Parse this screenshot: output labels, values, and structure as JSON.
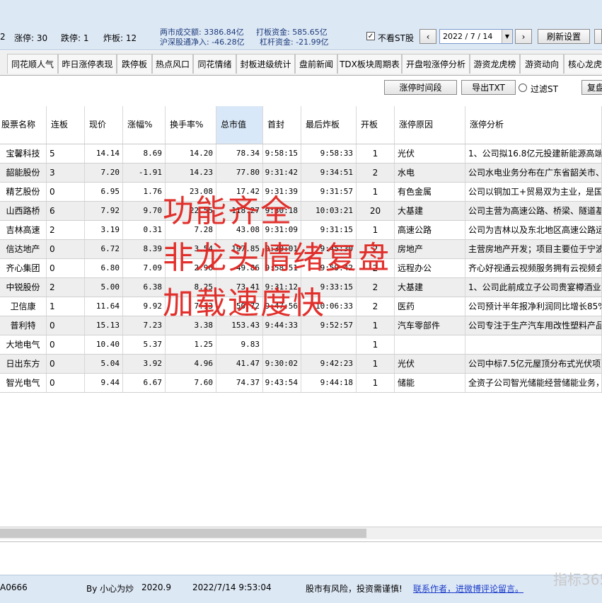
{
  "stats": {
    "limit_up_partial": "2",
    "limit_up": "涨停: 30",
    "limit_down": "跌停: 1",
    "broken": "炸板: 12"
  },
  "market": {
    "turnover": "两市成交额: 3386.84亿",
    "hit_funds": "打板资金: 585.65亿",
    "north_flow": "沪深股通净入: -46.28亿",
    "leverage_funds": "杠杆资金: -21.99亿"
  },
  "controls": {
    "hide_st_checked": true,
    "hide_st_label": "不看ST股",
    "prev_arrow": "‹",
    "next_arrow": "›",
    "date_value": "2022 / 7 / 14",
    "refresh_label": "刷新设置"
  },
  "tabs": [
    "同花顺人气",
    "昨日涨停表现",
    "跌停板",
    "热点风口",
    "同花情绪",
    "封板进级统计",
    "盘前新闻",
    "TDX板块周期表",
    "开盘啦涨停分析",
    "游资龙虎榜",
    "游资动向",
    "核心龙虎"
  ],
  "toolbar": {
    "limit_time_label": "涨停时间段",
    "export_label": "导出TXT",
    "filter_st_label": "过滤ST",
    "review_label": "复盘"
  },
  "table": {
    "columns": [
      "股票名称",
      "连板",
      "现价",
      "涨幅%",
      "换手率%",
      "总市值",
      "首封",
      "最后炸板",
      "开板",
      "涨停原因",
      "涨停分析"
    ],
    "rows": [
      [
        "宝馨科技",
        "5",
        "14.14",
        "8.69",
        "14.20",
        "78.34",
        "9:58:15",
        "9:58:33",
        "1",
        "光伏",
        "1、公司拟16.8亿元投建新能源高端装"
      ],
      [
        "韶能股份",
        "3",
        "7.20",
        "-1.91",
        "14.23",
        "77.80",
        "9:31:42",
        "9:34:51",
        "2",
        "水电",
        "公司水电业务分布在广东省韶关市、"
      ],
      [
        "精艺股份",
        "0",
        "6.95",
        "1.76",
        "23.08",
        "17.42",
        "9:31:39",
        "9:31:57",
        "1",
        "有色金属",
        "公司以铜加工+贸易双为主业，是国内"
      ],
      [
        "山西路桥",
        "6",
        "7.92",
        "9.70",
        "22.55",
        "118.27",
        "9:30:18",
        "10:03:21",
        "20",
        "大基建",
        "公司主营为高速公路、桥梁、隧道基"
      ],
      [
        "吉林高速",
        "2",
        "3.19",
        "0.31",
        "7.28",
        "43.08",
        "9:31:09",
        "9:31:15",
        "1",
        "高速公路",
        "公司为吉林以及东北地区高速公路运"
      ],
      [
        "信达地产",
        "0",
        "6.72",
        "8.39",
        "3.54",
        "197.85",
        "9:30:01",
        "9:45:30",
        "2",
        "房地产",
        "主营房地产开发；项目主要位于宁波"
      ],
      [
        "齐心集团",
        "0",
        "6.80",
        "7.09",
        "2.96",
        "49.86",
        "9:58:51",
        "9:59:42",
        "2",
        "远程办公",
        "齐心好视通云视频服务拥有云视频会"
      ],
      [
        "中锐股份",
        "2",
        "5.00",
        "6.38",
        "8.25",
        "73.41",
        "9:31:12",
        "9:33:15",
        "2",
        "大基建",
        "1、公司此前成立子公司贵宴樽酒业"
      ],
      [
        "卫信康",
        "1",
        "11.64",
        "9.92",
        "7.13",
        "50.72",
        "9:47:56",
        "10:06:33",
        "2",
        "医药",
        "公司预计半年报净利润同比增长85%"
      ],
      [
        "普利特",
        "0",
        "15.13",
        "7.23",
        "3.38",
        "153.43",
        "9:44:33",
        "9:52:57",
        "1",
        "汽车零部件",
        "公司专注于生产汽车用改性塑料产品"
      ],
      [
        "大地电气",
        "0",
        "10.40",
        "5.37",
        "1.25",
        "9.83",
        "",
        "",
        "1",
        "",
        ""
      ],
      [
        "日出东方",
        "0",
        "5.04",
        "3.92",
        "4.96",
        "41.47",
        "9:30:02",
        "9:42:23",
        "1",
        "光伏",
        "公司中标7.5亿元屋顶分布式光伏项目"
      ],
      [
        "智光电气",
        "0",
        "9.44",
        "6.67",
        "7.60",
        "74.37",
        "9:43:54",
        "9:44:18",
        "1",
        "储能",
        "全资子公司智光储能经营储能业务，"
      ]
    ]
  },
  "overlay": {
    "line1": "功能齐全",
    "line2": "非龙头情绪复盘",
    "line3": "加载速度快"
  },
  "statusbar": {
    "code": "A0666",
    "author": "By 小心为炒",
    "version": "2020.9",
    "datetime": "2022/7/14 9:53:04",
    "risk": "股市有风险，投资需谨慎!",
    "contact_link": "联系作者，进微博评论留言。",
    "watermark": "指标365"
  },
  "colors": {
    "header_bg": "#dde8f5",
    "overlay_red": "#e0201c",
    "link_blue": "#1a3cc8",
    "highlight_col": "#d8e8f8"
  }
}
